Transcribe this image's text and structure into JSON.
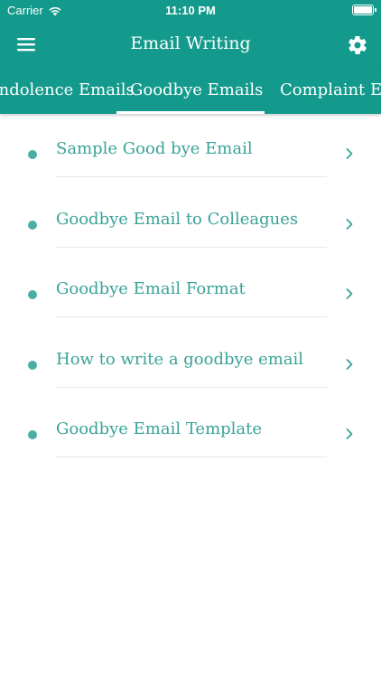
{
  "status_bar": {
    "carrier": "Carrier",
    "time": "11:10 PM"
  },
  "header": {
    "title": "Email Writing",
    "menu_icon": "hamburger-icon",
    "settings_icon": "gear-icon"
  },
  "tabs": [
    {
      "label": "Condolence Emails",
      "selected": false
    },
    {
      "label": "Goodbye Emails",
      "selected": true
    },
    {
      "label": "Complaint Emails",
      "selected": false
    }
  ],
  "items": [
    {
      "label": "Sample Good bye Email"
    },
    {
      "label": "Goodbye Email to Colleagues"
    },
    {
      "label": "Goodbye Email Format"
    },
    {
      "label": "How to write a goodbye email"
    },
    {
      "label": "Goodbye Email Template"
    }
  ],
  "colors": {
    "primary": "#149a8c",
    "text_accent": "#3aa398",
    "bullet": "#4aaea2",
    "divider": "#e8e8e8"
  }
}
